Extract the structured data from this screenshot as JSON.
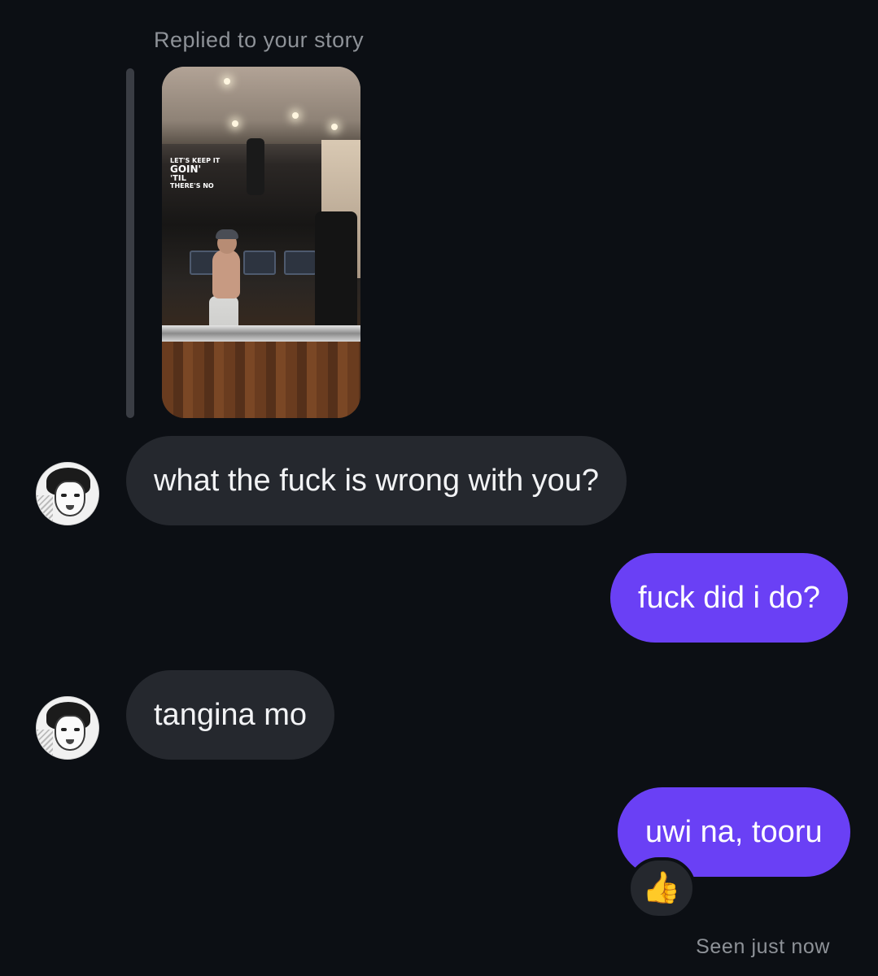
{
  "reply": {
    "label": "Replied to your story"
  },
  "story": {
    "overlay_lines": [
      "LET'S KEEP IT",
      "GOIN'",
      "'TIL",
      "THERE'S NO"
    ]
  },
  "messages": [
    {
      "sender": "them",
      "text": "what the fuck is wrong with you?"
    },
    {
      "sender": "me",
      "text": "fuck did i do?"
    },
    {
      "sender": "them",
      "text": "tangina mo"
    },
    {
      "sender": "me",
      "text": "uwi na, tooru"
    }
  ],
  "reaction": {
    "emoji": "👍"
  },
  "status": {
    "seen": "Seen just now"
  },
  "colors": {
    "background": "#0c0f14",
    "incoming_bubble": "#25282e",
    "outgoing_bubble": "#6a40f5",
    "muted_text": "#8e9298"
  }
}
